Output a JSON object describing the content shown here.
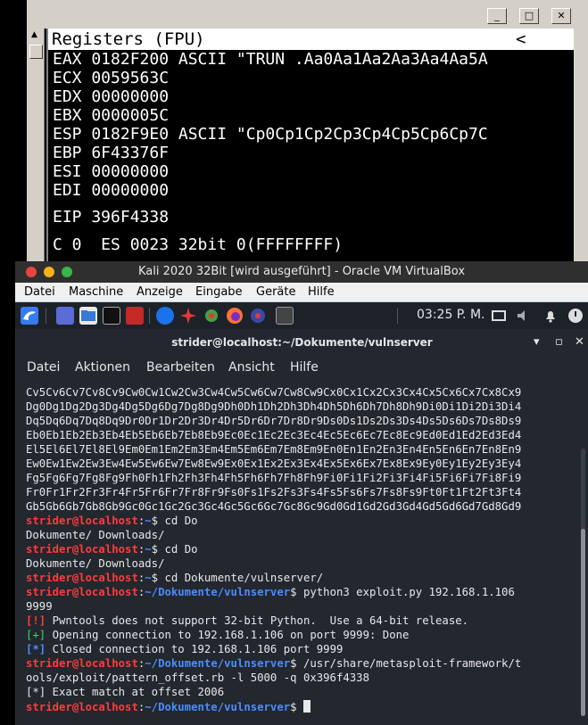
{
  "debugger": {
    "pane_title": "Registers (FPU)",
    "pane_marker": "<",
    "min_label": "_",
    "max_label": "□",
    "close_label": "✕",
    "registers": [
      "EAX 0182F200 ASCII \"TRUN .Aa0Aa1Aa2Aa3Aa4Aa5A",
      "ECX 0059563C",
      "EDX 00000000",
      "EBX 0000005C",
      "ESP 0182F9E0 ASCII \"Cp0Cp1Cp2Cp3Cp4Cp5Cp6Cp7C",
      "EBP 6F43376F",
      "ESI 00000000",
      "EDI 00000000",
      "EIP 396F4338",
      "C 0  ES 0023 32bit 0(FFFFFFFF)"
    ]
  },
  "vbox": {
    "title": "Kali 2020 32Bit [wird ausgeführt] - Oracle VM VirtualBox",
    "menu": [
      "Datei",
      "Maschine",
      "Anzeige",
      "Eingabe",
      "Geräte",
      "Hilfe"
    ]
  },
  "panel": {
    "clock": "03:25 P. M."
  },
  "terminal": {
    "title": "strider@localhost:~/Dokumente/vulnserver",
    "menu": [
      "Datei",
      "Aktionen",
      "Bearbeiten",
      "Ansicht",
      "Hilfe"
    ],
    "pattern_lines": [
      "Cv5Cv6Cv7Cv8Cv9Cw0Cw1Cw2Cw3Cw4Cw5Cw6Cw7Cw8Cw9Cx0Cx1Cx2Cx3Cx4Cx5Cx6Cx7Cx8Cx9",
      "Dg0Dg1Dg2Dg3Dg4Dg5Dg6Dg7Dg8Dg9Dh0Dh1Dh2Dh3Dh4Dh5Dh6Dh7Dh8Dh9Di0Di1Di2Di3Di4",
      "Dq5Dq6Dq7Dq8Dq9Dr0Dr1Dr2Dr3Dr4Dr5Dr6Dr7Dr8Dr9Ds0Ds1Ds2Ds3Ds4Ds5Ds6Ds7Ds8Ds9",
      "Eb0Eb1Eb2Eb3Eb4Eb5Eb6Eb7Eb8Eb9Ec0Ec1Ec2Ec3Ec4Ec5Ec6Ec7Ec8Ec9Ed0Ed1Ed2Ed3Ed4",
      "El5El6El7El8El9Em0Em1Em2Em3Em4Em5Em6Em7Em8Em9En0En1En2En3En4En5En6En7En8En9",
      "Ew0Ew1Ew2Ew3Ew4Ew5Ew6Ew7Ew8Ew9Ex0Ex1Ex2Ex3Ex4Ex5Ex6Ex7Ex8Ex9Ey0Ey1Ey2Ey3Ey4",
      "Fg5Fg6Fg7Fg8Fg9Fh0Fh1Fh2Fh3Fh4Fh5Fh6Fh7Fh8Fh9Fi0Fi1Fi2Fi3Fi4Fi5Fi6Fi7Fi8Fi9",
      "Fr0Fr1Fr2Fr3Fr4Fr5Fr6Fr7Fr8Fr9Fs0Fs1Fs2Fs3Fs4Fs5Fs6Fs7Fs8Fs9Ft0Ft1Ft2Ft3Ft4",
      "Gb5Gb6Gb7Gb8Gb9Gc0Gc1Gc2Gc3Gc4Gc5Gc6Gc7Gc8Gc9Gd0Gd1Gd2Gd3Gd4Gd5Gd6Gd7Gd8Gd9"
    ],
    "prompt_user": "strider@localhost",
    "sep": ":",
    "dir_home": "~",
    "dir_vuln": "~/Dokumente/vulnserver",
    "dollar": "$",
    "cmd1": " cd Do",
    "out1": "Dokumente/ Downloads/",
    "cmd2": " cd Do",
    "out2": "Dokumente/ Downloads/",
    "cmd3": " cd Dokumente/vulnserver/",
    "cmd4": " python3 exploit.py 192.168.1.106",
    "cmd4_cont": "9999",
    "log": [
      {
        "mark": "[!]",
        "text": " Pwntools does not support 32-bit Python.  Use a 64-bit release."
      },
      {
        "mark": "[+]",
        "text": " Opening connection to 192.168.1.106 on port 9999: Done"
      },
      {
        "mark": "[*]",
        "text": " Closed connection to 192.168.1.106 port 9999"
      }
    ],
    "cmd5": " /usr/share/metasploit-framework/t",
    "cmd5_cont": "ools/exploit/pattern_offset.rb -l 5000 -q 0x396f4338",
    "result": "[*] Exact match at offset 2006"
  }
}
